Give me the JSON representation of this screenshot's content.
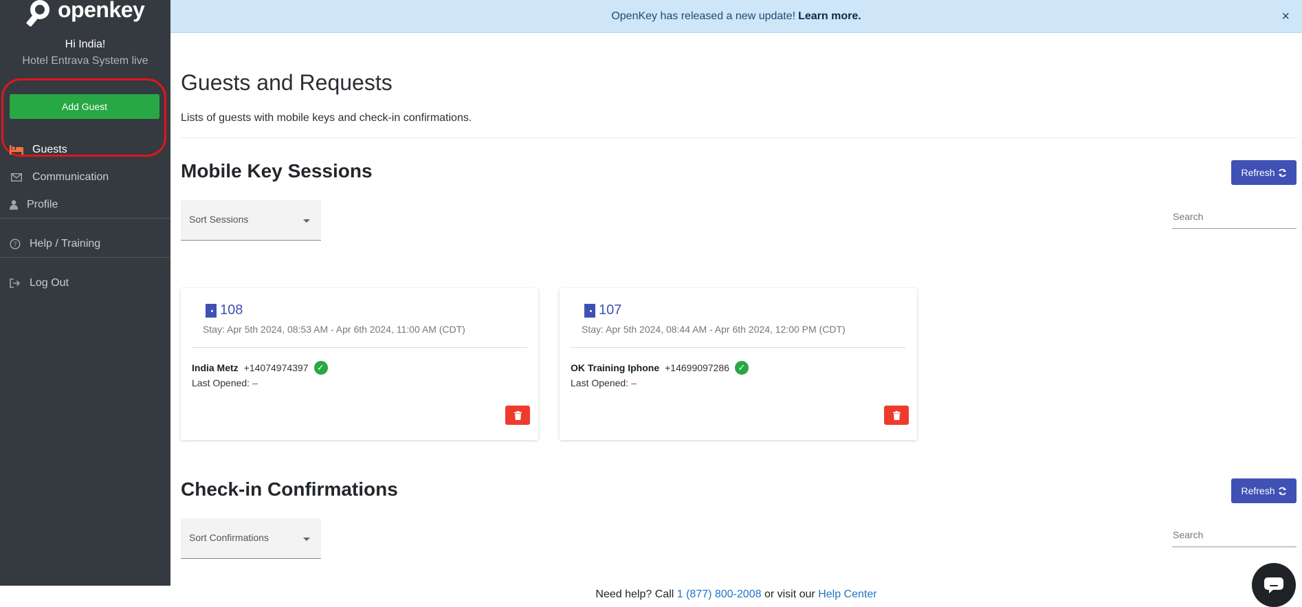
{
  "sidebar": {
    "brand": "openkey",
    "greeting": "Hi India!",
    "hotel": "Hotel Entrava System live",
    "add_guest_label": "Add Guest",
    "items": [
      {
        "label": "Guests",
        "icon": "bed-icon"
      },
      {
        "label": "Communication",
        "icon": "envelope-icon"
      },
      {
        "label": "Profile",
        "icon": "user-icon"
      },
      {
        "label": "Help / Training",
        "icon": "question-circle-icon"
      },
      {
        "label": "Log Out",
        "icon": "sign-out-icon"
      }
    ]
  },
  "banner": {
    "text": "OpenKey has released a new update!",
    "link": "Learn more.",
    "close": "×"
  },
  "main": {
    "title": "Guests and Requests",
    "description": "Lists of guests with mobile keys and check-in confirmations.",
    "sessions": {
      "title": "Mobile Key Sessions",
      "refresh_label": "Refresh",
      "sort_label": "Sort Sessions",
      "search_placeholder": "Search",
      "cards": [
        {
          "room": "108",
          "stay": "Stay: Apr 5th 2024, 08:53 AM - Apr 6th 2024, 11:00 AM (CDT)",
          "guest": "India Metz",
          "phone": "+14074974397",
          "last_opened_label": "Last Opened:",
          "last_opened_value": "–"
        },
        {
          "room": "107",
          "stay": "Stay: Apr 5th 2024, 08:44 AM - Apr 6th 2024, 12:00 PM (CDT)",
          "guest": "OK Training Iphone",
          "phone": "+14699097286",
          "last_opened_label": "Last Opened:",
          "last_opened_value": "–"
        }
      ]
    },
    "confirmations": {
      "title": "Check-in Confirmations",
      "refresh_label": "Refresh",
      "sort_label": "Sort Confirmations",
      "search_placeholder": "Search"
    }
  },
  "footer": {
    "prefix": "Need help? Call",
    "phone": "1 (877) 800-2008",
    "middle": "or visit our",
    "link": "Help Center"
  },
  "colors": {
    "sidebar_bg": "#353a40",
    "accent": "#3f51b5",
    "success": "#28a745",
    "danger": "#ef3b2d",
    "banner_bg": "#cfe5f8",
    "highlight": "#e0161b"
  }
}
